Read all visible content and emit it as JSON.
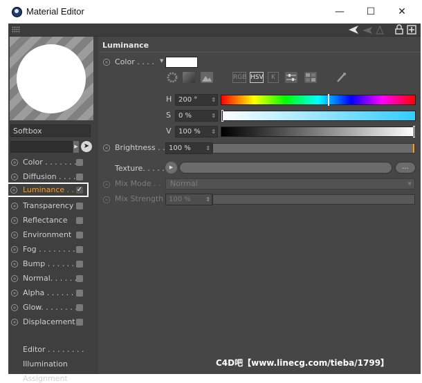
{
  "window": {
    "title": "Material Editor",
    "minimize": "—",
    "maximize": "☐",
    "close": "✕"
  },
  "preview": {
    "material_name": "Softbox"
  },
  "channels": [
    {
      "label": "Color . . . . . . . ."
    },
    {
      "label": "Diffusion . . . . ."
    },
    {
      "label": "Luminance . . ."
    },
    {
      "label": "Transparency"
    },
    {
      "label": "Reflectance"
    },
    {
      "label": "Environment"
    },
    {
      "label": "Fog . . . . . . . . ."
    },
    {
      "label": "Bump . . . . . . ."
    },
    {
      "label": "Normal. . . . . . ."
    },
    {
      "label": "Alpha . . . . . . ."
    },
    {
      "label": "Glow. . . . . . . ."
    },
    {
      "label": "Displacement"
    }
  ],
  "extra_items": [
    {
      "label": "Editor . . . . . . . ."
    },
    {
      "label": "Illumination"
    },
    {
      "label": "Assignment"
    }
  ],
  "luminance": {
    "header": "Luminance",
    "color_label": "Color . . . .",
    "color_swatch": "#ffffff",
    "mode_buttons": [
      "RGB",
      "HSV",
      "K"
    ],
    "active_mode": "HSV",
    "h_label": "H",
    "h_value": "200 °",
    "s_label": "S",
    "s_value": "0 %",
    "v_label": "V",
    "v_value": "100 %",
    "brightness_label": "Brightness . .",
    "brightness_value": "100 %",
    "texture_label": "Texture. . . . .",
    "texture_more": "...",
    "mixmode_label": "Mix Mode . .",
    "mixmode_value": "Normal",
    "mixstrength_label": "Mix Strength",
    "mixstrength_value": "100 %"
  },
  "watermark": "C4D吧【www.linecg.com/tieba/1799】",
  "icons": [
    "material-editor-icon",
    "back-arrow-icon",
    "lock-icon",
    "new-window-icon",
    "color-wheel-icon",
    "spectrum-icon",
    "picture-icon",
    "color-mixer-icon",
    "sliders-icon",
    "palette-icon",
    "eyedropper-icon",
    "pointer-icon",
    "play-icon"
  ]
}
